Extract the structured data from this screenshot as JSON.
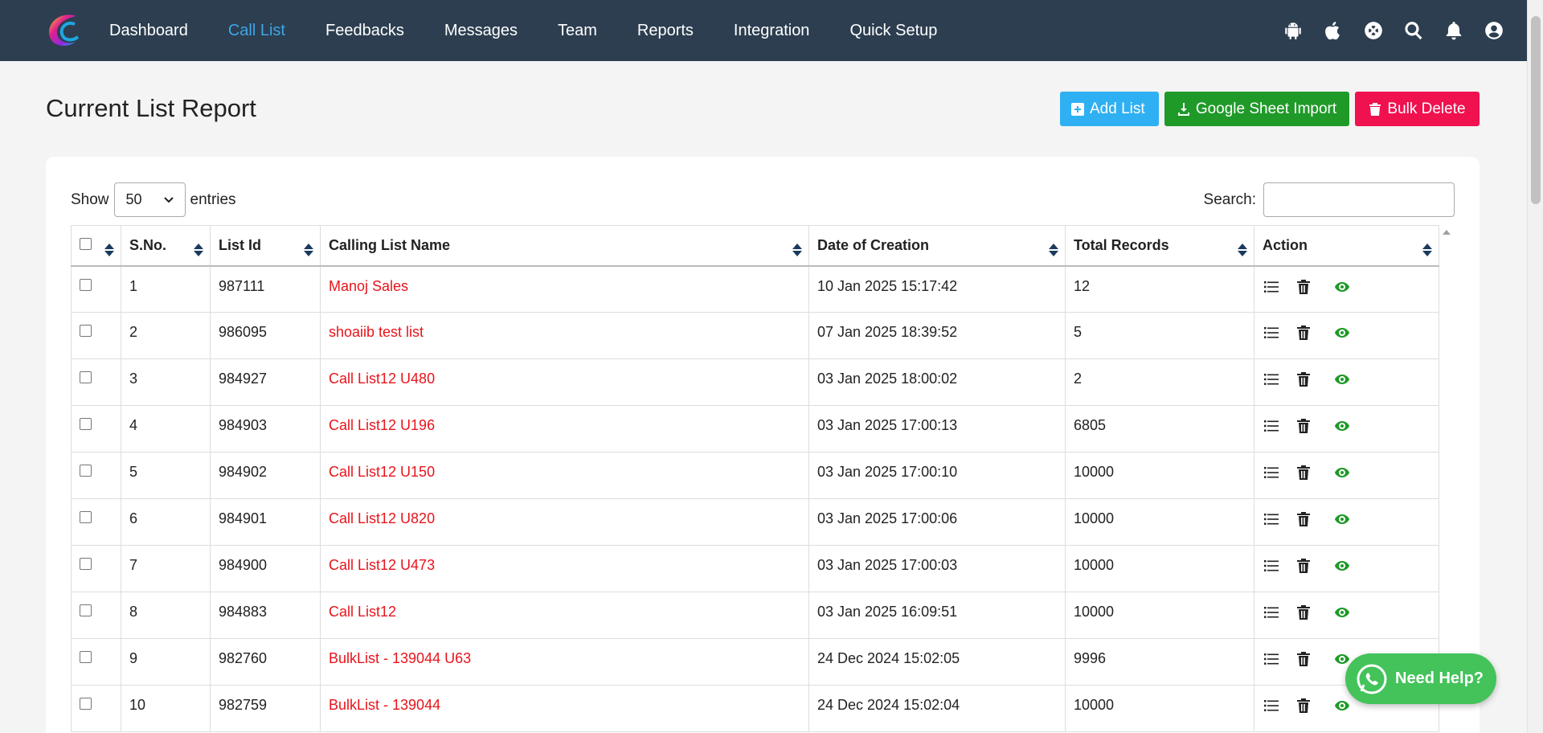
{
  "nav": {
    "links": [
      "Dashboard",
      "Call List",
      "Feedbacks",
      "Messages",
      "Team",
      "Reports",
      "Integration",
      "Quick Setup"
    ],
    "active": "Call List",
    "icons": [
      "android-icon",
      "apple-icon",
      "support-icon",
      "search-icon",
      "bell-icon",
      "user-icon"
    ]
  },
  "page": {
    "title": "Current List Report"
  },
  "actions": {
    "add_list": "Add List",
    "google_sheet_import": "Google Sheet Import",
    "bulk_delete": "Bulk Delete"
  },
  "table_controls": {
    "show_label": "Show",
    "entries_value": "50",
    "entries_label": "entries",
    "search_label": "Search:",
    "search_value": ""
  },
  "table": {
    "headers": [
      "S.No.",
      "List Id",
      "Calling List Name",
      "Date of Creation",
      "Total Records",
      "Action"
    ],
    "rows": [
      {
        "sno": "1",
        "list_id": "987111",
        "name": "Manoj Sales",
        "date": "10 Jan 2025 15:17:42",
        "total": "12"
      },
      {
        "sno": "2",
        "list_id": "986095",
        "name": "shoaiib test list",
        "date": "07 Jan 2025 18:39:52",
        "total": "5"
      },
      {
        "sno": "3",
        "list_id": "984927",
        "name": "Call List12 U480",
        "date": "03 Jan 2025 18:00:02",
        "total": "2"
      },
      {
        "sno": "4",
        "list_id": "984903",
        "name": "Call List12 U196",
        "date": "03 Jan 2025 17:00:13",
        "total": "6805"
      },
      {
        "sno": "5",
        "list_id": "984902",
        "name": "Call List12 U150",
        "date": "03 Jan 2025 17:00:10",
        "total": "10000"
      },
      {
        "sno": "6",
        "list_id": "984901",
        "name": "Call List12 U820",
        "date": "03 Jan 2025 17:00:06",
        "total": "10000"
      },
      {
        "sno": "7",
        "list_id": "984900",
        "name": "Call List12 U473",
        "date": "03 Jan 2025 17:00:03",
        "total": "10000"
      },
      {
        "sno": "8",
        "list_id": "984883",
        "name": "Call List12",
        "date": "03 Jan 2025 16:09:51",
        "total": "10000"
      },
      {
        "sno": "9",
        "list_id": "982760",
        "name": "BulkList - 139044 U63",
        "date": "24 Dec 2024 15:02:05",
        "total": "9996"
      },
      {
        "sno": "10",
        "list_id": "982759",
        "name": "BulkList - 139044",
        "date": "24 Dec 2024 15:02:04",
        "total": "10000"
      }
    ]
  },
  "help_widget": {
    "label": "Need Help?"
  },
  "colors": {
    "navbar": "#2c3e50",
    "active_link": "#3fa7e8",
    "add_button": "#2fb0f2",
    "import_button": "#1f9a29",
    "delete_button": "#f0114f",
    "list_name": "#e8141b",
    "view_icon": "#1f9a29",
    "help_widget": "#43c35a"
  }
}
